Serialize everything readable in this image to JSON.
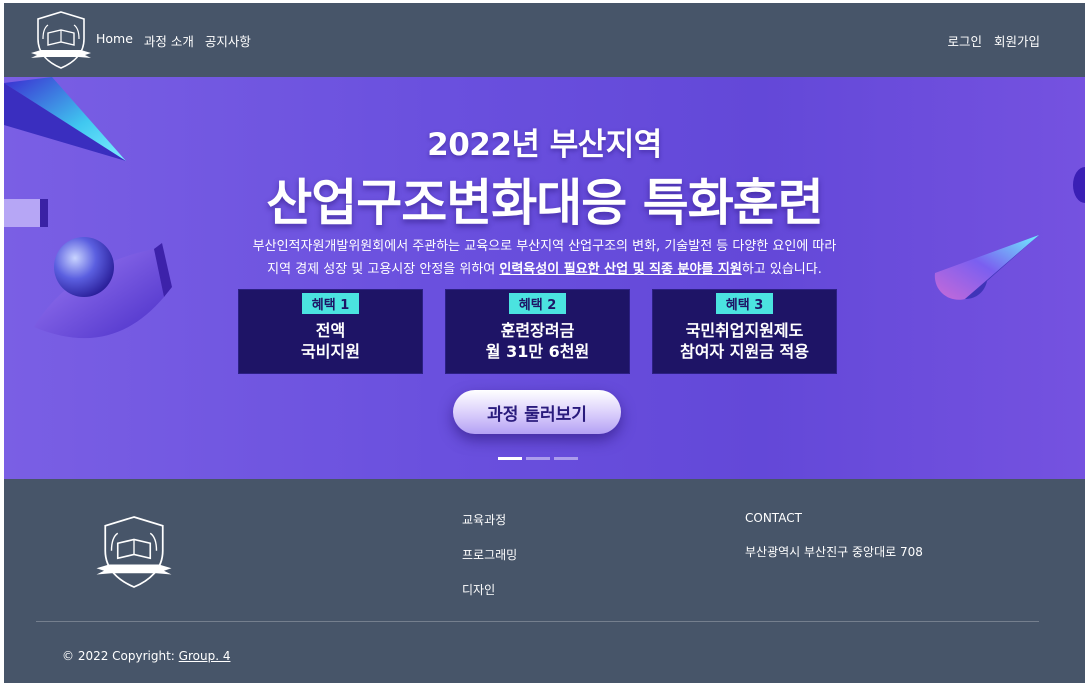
{
  "header": {
    "nav_left": [
      "Home",
      "과정 소개",
      "공지사항"
    ],
    "nav_right": [
      "로그인",
      "회원가입"
    ]
  },
  "hero": {
    "title1": "2022년 부산지역",
    "title2": "산업구조변화대응 특화훈련",
    "desc_line1": "부산인적자원개발위원회에서 주관하는 교육으로 부산지역 산업구조의 변화, 기술발전 등 다양한 요인에 따라",
    "desc_line2_pre": "지역 경제 성장 및 고용시장 안정을 위하여 ",
    "desc_line2_strong": "인력육성이 필요한 산업 및 직종 분야를 지원",
    "desc_line2_post": "하고 있습니다.",
    "benefits": [
      {
        "tag": "혜택 1",
        "line1": "전액",
        "line2": "국비지원"
      },
      {
        "tag": "혜택 2",
        "line1": "훈련장려금",
        "line2": "월 31만 6천원"
      },
      {
        "tag": "혜택 3",
        "line1": "국민취업지원제도",
        "line2": "참여자 지원금 적용"
      }
    ],
    "cta_label": "과정 둘러보기"
  },
  "footer": {
    "links": [
      "교육과정",
      "프로그래밍",
      "디자인"
    ],
    "contact_title": "CONTACT",
    "address": "부산광역시 부산진구 중앙대로 708",
    "copyright_prefix": "© 2022 Copyright: ",
    "copyright_link": "Group. 4"
  },
  "colors": {
    "header_bg": "#475569",
    "hero_bg": "#6a50de",
    "benefit_bg": "#1e1466",
    "benefit_tag": "#4be3e0"
  },
  "icons": [
    "shield-book-logo-icon"
  ]
}
